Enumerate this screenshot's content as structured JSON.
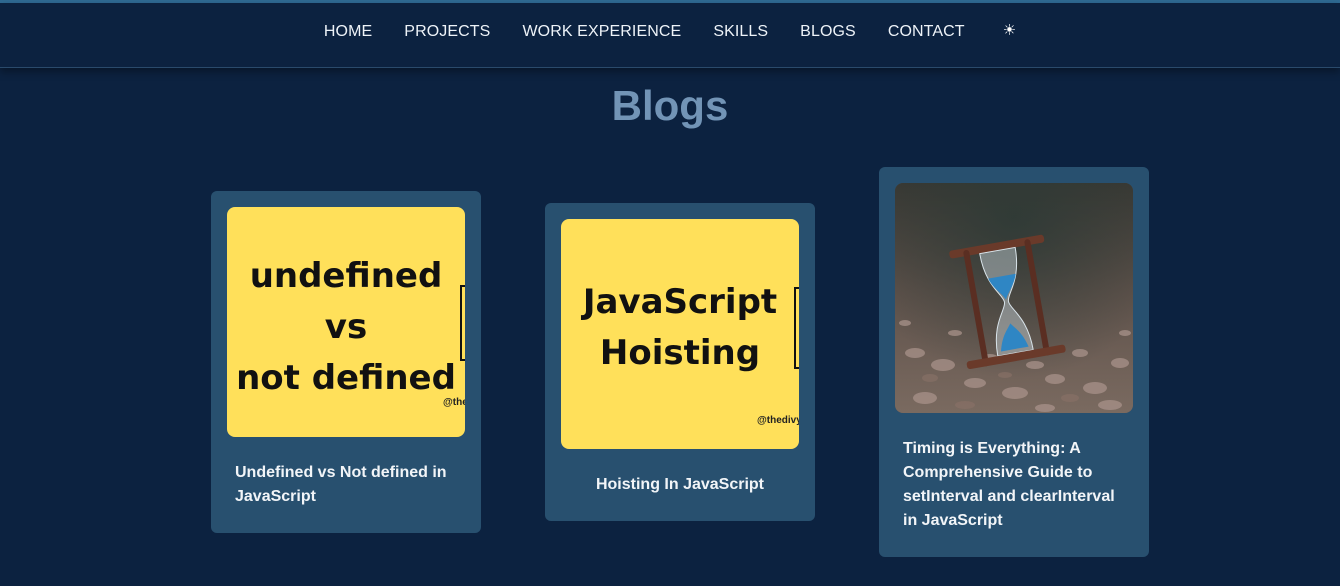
{
  "nav": {
    "items": [
      "HOME",
      "PROJECTS",
      "WORK EXPERIENCE",
      "SKILLS",
      "BLOGS",
      "CONTACT"
    ],
    "theme_icon": "☀"
  },
  "section": {
    "title": "Blogs"
  },
  "blogs": [
    {
      "thumb_lines": [
        "undefined",
        "vs",
        "not defined"
      ],
      "watermark": "@the",
      "title": "Undefined vs Not defined in JavaScript"
    },
    {
      "thumb_lines": [
        "JavaScript",
        "Hoisting"
      ],
      "watermark": "@thedivy",
      "title": "Hoisting In JavaScript"
    },
    {
      "thumb_icon": "hourglass-photo",
      "title": "Timing is Everything: A Comprehensive Guide to setInterval and clearInterval in JavaScript"
    }
  ],
  "colors": {
    "background": "#0c2240",
    "card": "#28506f",
    "thumb_yellow": "#ffe05a",
    "title": "#7294b6"
  }
}
